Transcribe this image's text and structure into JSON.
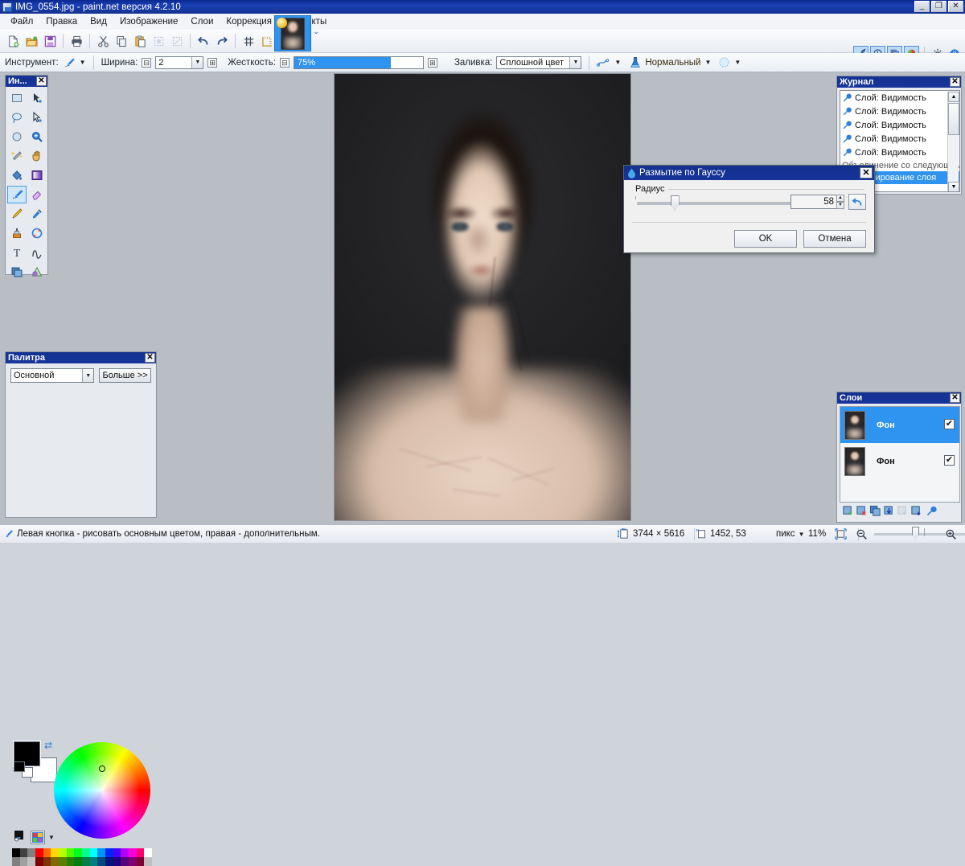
{
  "window": {
    "title": "IMG_0554.jpg - paint.net версия 4.2.10",
    "app_icon": "paintnet-icon",
    "minimize": "_",
    "restore": "❐",
    "close": "✕"
  },
  "menu": {
    "items": [
      {
        "label": "Файл",
        "name": "menu-file"
      },
      {
        "label": "Правка",
        "name": "menu-edit"
      },
      {
        "label": "Вид",
        "name": "menu-view"
      },
      {
        "label": "Изображение",
        "name": "menu-image"
      },
      {
        "label": "Слои",
        "name": "menu-layers"
      },
      {
        "label": "Коррекция",
        "name": "menu-adjustments"
      },
      {
        "label": "Эффекты",
        "name": "menu-effects"
      }
    ]
  },
  "toolbar": {
    "buttons": [
      {
        "name": "new-icon",
        "glyph": "🗋"
      },
      {
        "name": "open-icon",
        "glyph": "📂"
      },
      {
        "name": "save-icon",
        "glyph": "💾"
      },
      {
        "name": "print-icon",
        "glyph": "🖶"
      },
      {
        "name": "cut-icon",
        "glyph": "✂"
      },
      {
        "name": "copy-icon",
        "glyph": "⧉"
      },
      {
        "name": "paste-icon",
        "glyph": "📋"
      },
      {
        "name": "crop-icon",
        "glyph": "⬚"
      },
      {
        "name": "deselect-icon",
        "glyph": "▨"
      },
      {
        "name": "undo-icon",
        "glyph": "↶"
      },
      {
        "name": "redo-icon",
        "glyph": "↷"
      },
      {
        "name": "grid-icon",
        "glyph": "#"
      },
      {
        "name": "rulers-icon",
        "glyph": "📐"
      }
    ],
    "tab_tooltip": "IMG_0554.jpg",
    "tab_chevron": "⌄",
    "right_buttons": [
      {
        "name": "tools-window-icon",
        "glyph": "🔨",
        "active": true
      },
      {
        "name": "history-window-icon",
        "glyph": "🕘",
        "active": true
      },
      {
        "name": "layers-window-icon",
        "glyph": "◳",
        "active": true
      },
      {
        "name": "colors-window-icon",
        "glyph": "🎨",
        "active": true
      },
      {
        "name": "settings-icon",
        "glyph": "⚙",
        "active": false
      },
      {
        "name": "help-icon",
        "glyph": "?",
        "active": false
      }
    ]
  },
  "tool_options": {
    "tool_label": "Инструмент:",
    "tool_icon": "paintbrush-icon",
    "width_label": "Ширина:",
    "width_value": "2",
    "hardness_label": "Жесткость:",
    "hardness_value": "75%",
    "hardness_percent": 75,
    "fill_label": "Заливка:",
    "fill_value": "Сплошной цвет",
    "smoothing_icon": "antialiasing-icon",
    "blend_icon": "blend-flask-icon",
    "blend_mode": "Нормальный",
    "alpha_icon": "alpha-blending-icon",
    "decrement": "⊟",
    "increment": "⊞",
    "dropdown_arrow": "▼"
  },
  "tools_panel": {
    "title": "Ин...",
    "close": "✕",
    "tools": [
      {
        "name": "rectangle-select-tool",
        "glyph": "▭",
        "selected": false
      },
      {
        "name": "move-selected-tool",
        "glyph": "➤",
        "selected": false
      },
      {
        "name": "lasso-select-tool",
        "glyph": "◯",
        "selected": false
      },
      {
        "name": "move-selection-tool",
        "glyph": "➣",
        "selected": false
      },
      {
        "name": "ellipse-select-tool",
        "glyph": "⬭",
        "selected": false
      },
      {
        "name": "zoom-tool",
        "glyph": "🔍",
        "selected": false
      },
      {
        "name": "magic-wand-tool",
        "glyph": "✨",
        "selected": false
      },
      {
        "name": "pan-tool",
        "glyph": "✋",
        "selected": false
      },
      {
        "name": "paint-bucket-tool",
        "glyph": "🪣",
        "selected": false
      },
      {
        "name": "gradient-tool",
        "glyph": "▣",
        "selected": false
      },
      {
        "name": "paintbrush-tool",
        "glyph": "🖌",
        "selected": true
      },
      {
        "name": "eraser-tool",
        "glyph": "◇",
        "selected": false
      },
      {
        "name": "pencil-tool",
        "glyph": "✏",
        "selected": false
      },
      {
        "name": "color-picker-tool",
        "glyph": "💉",
        "selected": false
      },
      {
        "name": "clone-stamp-tool",
        "glyph": "⚲",
        "selected": false
      },
      {
        "name": "recolor-tool",
        "glyph": "🔄",
        "selected": false
      },
      {
        "name": "text-tool",
        "glyph": "T",
        "selected": false
      },
      {
        "name": "line-curve-tool",
        "glyph": "∿",
        "selected": false
      },
      {
        "name": "rectangle-shape-tool",
        "glyph": "▥",
        "selected": false
      },
      {
        "name": "shapes-tool",
        "glyph": "△",
        "selected": false
      }
    ]
  },
  "palette_panel": {
    "title": "Палитра",
    "close": "✕",
    "mode": "Основной",
    "more_button": "Больше >>",
    "primary_color": "#000000",
    "secondary_color": "#ffffff",
    "swap_icon": "swap-colors-icon",
    "reset_icon": "reset-colors-icon",
    "palette_icon": "palette-chooser-icon",
    "dropdown_arrow": "▼",
    "swatch_rows": [
      [
        "#000000",
        "#404040",
        "#808080",
        "#ff0000",
        "#ff6a00",
        "#ffd800",
        "#b6ff00",
        "#4cff00",
        "#00ff21",
        "#00ff90",
        "#00ffff",
        "#0094ff",
        "#0026ff",
        "#4800ff",
        "#b200ff",
        "#ff00dc",
        "#ff006e",
        "#ffffff"
      ],
      [
        "#7f7f7f",
        "#a0a0a0",
        "#c0c0c0",
        "#7f0000",
        "#7f3300",
        "#7f6a00",
        "#5b7f00",
        "#267f00",
        "#007f0e",
        "#007f46",
        "#007f7f",
        "#004a7f",
        "#00137f",
        "#21007f",
        "#57007f",
        "#7f006e",
        "#7f0037",
        "#bfbfbf"
      ]
    ]
  },
  "history_panel": {
    "title": "Журнал",
    "close": "✕",
    "items": [
      {
        "label": "Слой: Видимость",
        "icon": "wrench-icon",
        "selected": false
      },
      {
        "label": "Слой: Видимость",
        "icon": "wrench-icon",
        "selected": false
      },
      {
        "label": "Слой: Видимость",
        "icon": "wrench-icon",
        "selected": false
      },
      {
        "label": "Слой: Видимость",
        "icon": "wrench-icon",
        "selected": false
      },
      {
        "label": "Слой: Видимость",
        "icon": "wrench-icon",
        "selected": false
      },
      {
        "label": "Объединение со следующим",
        "icon": "merge-icon",
        "selected": false
      },
      {
        "label": "Дублирование слоя",
        "icon": "duplicate-icon",
        "selected": true
      }
    ],
    "scroll_up": "▲",
    "scroll_down": "▼"
  },
  "layers_panel": {
    "title": "Слои",
    "close": "✕",
    "layers": [
      {
        "name": "Фон",
        "visible": true,
        "selected": true,
        "check": "✔"
      },
      {
        "name": "Фон",
        "visible": true,
        "selected": false,
        "check": "✔"
      }
    ],
    "toolbar_buttons": [
      {
        "name": "add-layer-icon",
        "glyph": "＋",
        "enabled": true
      },
      {
        "name": "delete-layer-icon",
        "glyph": "✕",
        "enabled": true
      },
      {
        "name": "duplicate-layer-icon",
        "glyph": "⧉",
        "enabled": true
      },
      {
        "name": "merge-layer-down-icon",
        "glyph": "⤓",
        "enabled": true
      },
      {
        "name": "move-layer-up-icon",
        "glyph": "⬆",
        "enabled": false
      },
      {
        "name": "move-layer-down-icon",
        "glyph": "⬇",
        "enabled": true
      },
      {
        "name": "layer-properties-icon",
        "glyph": "🔧",
        "enabled": true
      }
    ]
  },
  "dialog": {
    "title": "Размытие по Гауссу",
    "icon": "water-drop-icon",
    "close": "✕",
    "group_label": "Радиус",
    "radius_value": "58",
    "radius_percent": 23,
    "spin_up": "▲",
    "spin_down": "▼",
    "reset_icon": "reset-arrow-icon",
    "ok_label": "OK",
    "cancel_label": "Отмена"
  },
  "statusbar": {
    "hint_icon": "paintbrush-icon",
    "hint": "Левая кнопка - рисовать основным цветом, правая - дополнительным.",
    "size_icon": "image-size-icon",
    "image_size": "3744 × 5616",
    "cursor_icon": "cursor-position-icon",
    "cursor_position": "1452, 53",
    "units": "пикс",
    "units_arrow": "▼",
    "zoom_level": "11%",
    "fit_icon": "fit-to-window-icon",
    "zoom_out_icon": "zoom-out-icon",
    "zoom_in_icon": "zoom-in-icon"
  },
  "canvas": {
    "document_name": "IMG_0554.jpg",
    "zoom": "11%"
  }
}
